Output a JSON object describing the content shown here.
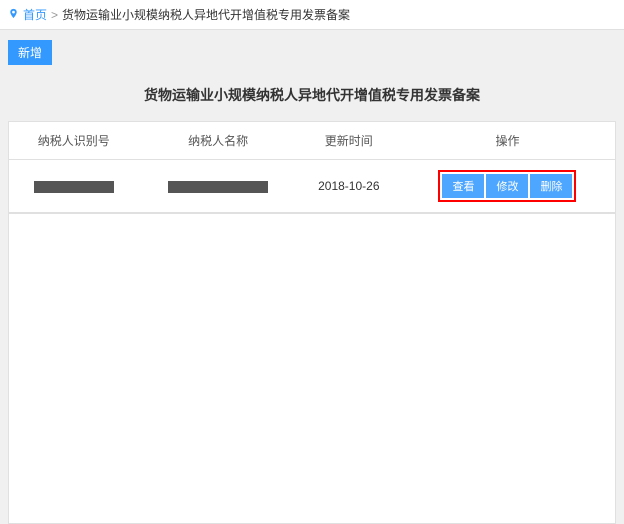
{
  "breadcrumb": {
    "home": "首页",
    "current": "货物运输业小规模纳税人异地代开增值税专用发票备案"
  },
  "toolbar": {
    "add_label": "新增"
  },
  "page": {
    "title": "货物运输业小规模纳税人异地代开增值税专用发票备案"
  },
  "table": {
    "headers": {
      "col1": "纳税人识别号",
      "col2": "纳税人名称",
      "col3": "更新时间",
      "col4": "操作"
    },
    "rows": [
      {
        "update_time": "2018-10-26",
        "actions": {
          "view": "查看",
          "edit": "修改",
          "delete": "删除"
        }
      }
    ]
  }
}
